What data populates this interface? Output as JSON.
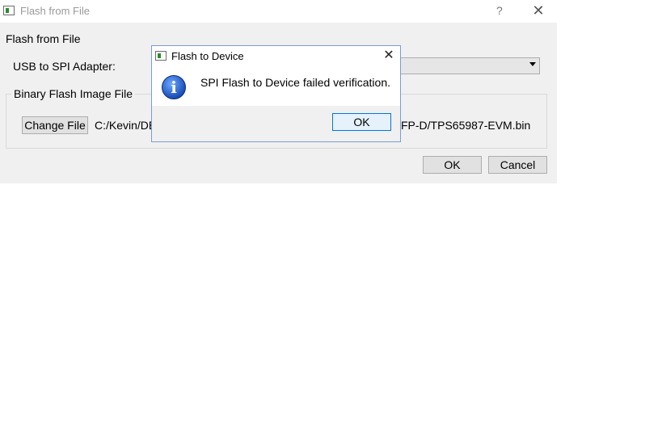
{
  "window": {
    "title": "Flash from File",
    "help": "?",
    "close": "✕"
  },
  "main": {
    "section_label": "Flash from File",
    "usb_label": "USB to SPI Adapter:",
    "combo_value": "",
    "group_title": "Binary Flash Image File",
    "change_file_label": "Change File",
    "path_visible_left": "C:/Kevin/DE",
    "path_visible_right": "FP-D/TPS65987-EVM.bin",
    "ok_label": "OK",
    "cancel_label": "Cancel"
  },
  "dialog": {
    "title": "Flash to Device",
    "close": "✕",
    "message": "SPI Flash to Device failed verification.",
    "icon_glyph": "i",
    "ok_label": "OK"
  }
}
